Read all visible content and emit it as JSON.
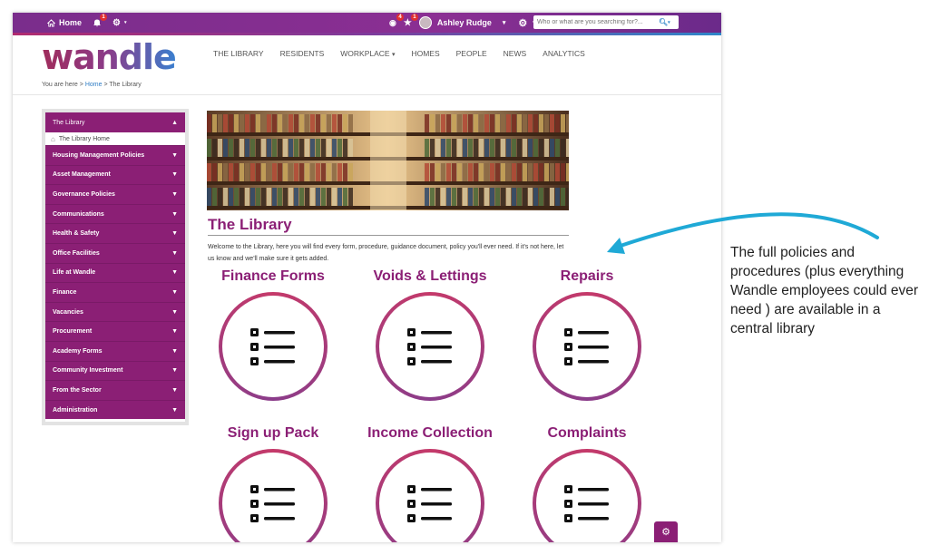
{
  "topbar": {
    "home_label": "Home",
    "notifications_count": "1",
    "views_count": "4",
    "favorites_count": "1",
    "user_name": "Ashley Rudge",
    "search_placeholder": "Who or what are you searching for?..."
  },
  "header": {
    "logo_text": "wandle",
    "nav": [
      "THE LIBRARY",
      "RESIDENTS",
      "WORKPLACE",
      "HOMES",
      "PEOPLE",
      "NEWS",
      "ANALYTICS"
    ]
  },
  "breadcrumb": {
    "prefix": "You are here >",
    "home": "Home",
    "separator": ">",
    "current": "The Library"
  },
  "sidebar": {
    "header": "The Library",
    "home_link": "The Library Home",
    "items": [
      "Housing Management Policies",
      "Asset Management",
      "Governance Policies",
      "Communications",
      "Health & Safety",
      "Office Facilities",
      "Life at Wandle",
      "Finance",
      "Vacancies",
      "Procurement",
      "Academy Forms",
      "Community Investment",
      "From the Sector",
      "Administration"
    ]
  },
  "main": {
    "title": "The Library",
    "intro": "Welcome to the Library, here you will find every form, procedure, guidance document, policy you'll ever need. If it's not here, let us know and we'll make sure it gets added.",
    "tiles": [
      "Finance Forms",
      "Voids & Lettings",
      "Repairs",
      "Sign up Pack",
      "Income Collection",
      "Complaints"
    ]
  },
  "annotation": {
    "text": "The full policies and procedures (plus everything Wandle employees could ever need ) are available in a central library"
  },
  "colors": {
    "brand_purple": "#8b1f75",
    "accent_blue": "#2f86c9",
    "arrow_blue": "#1fa9d6"
  }
}
